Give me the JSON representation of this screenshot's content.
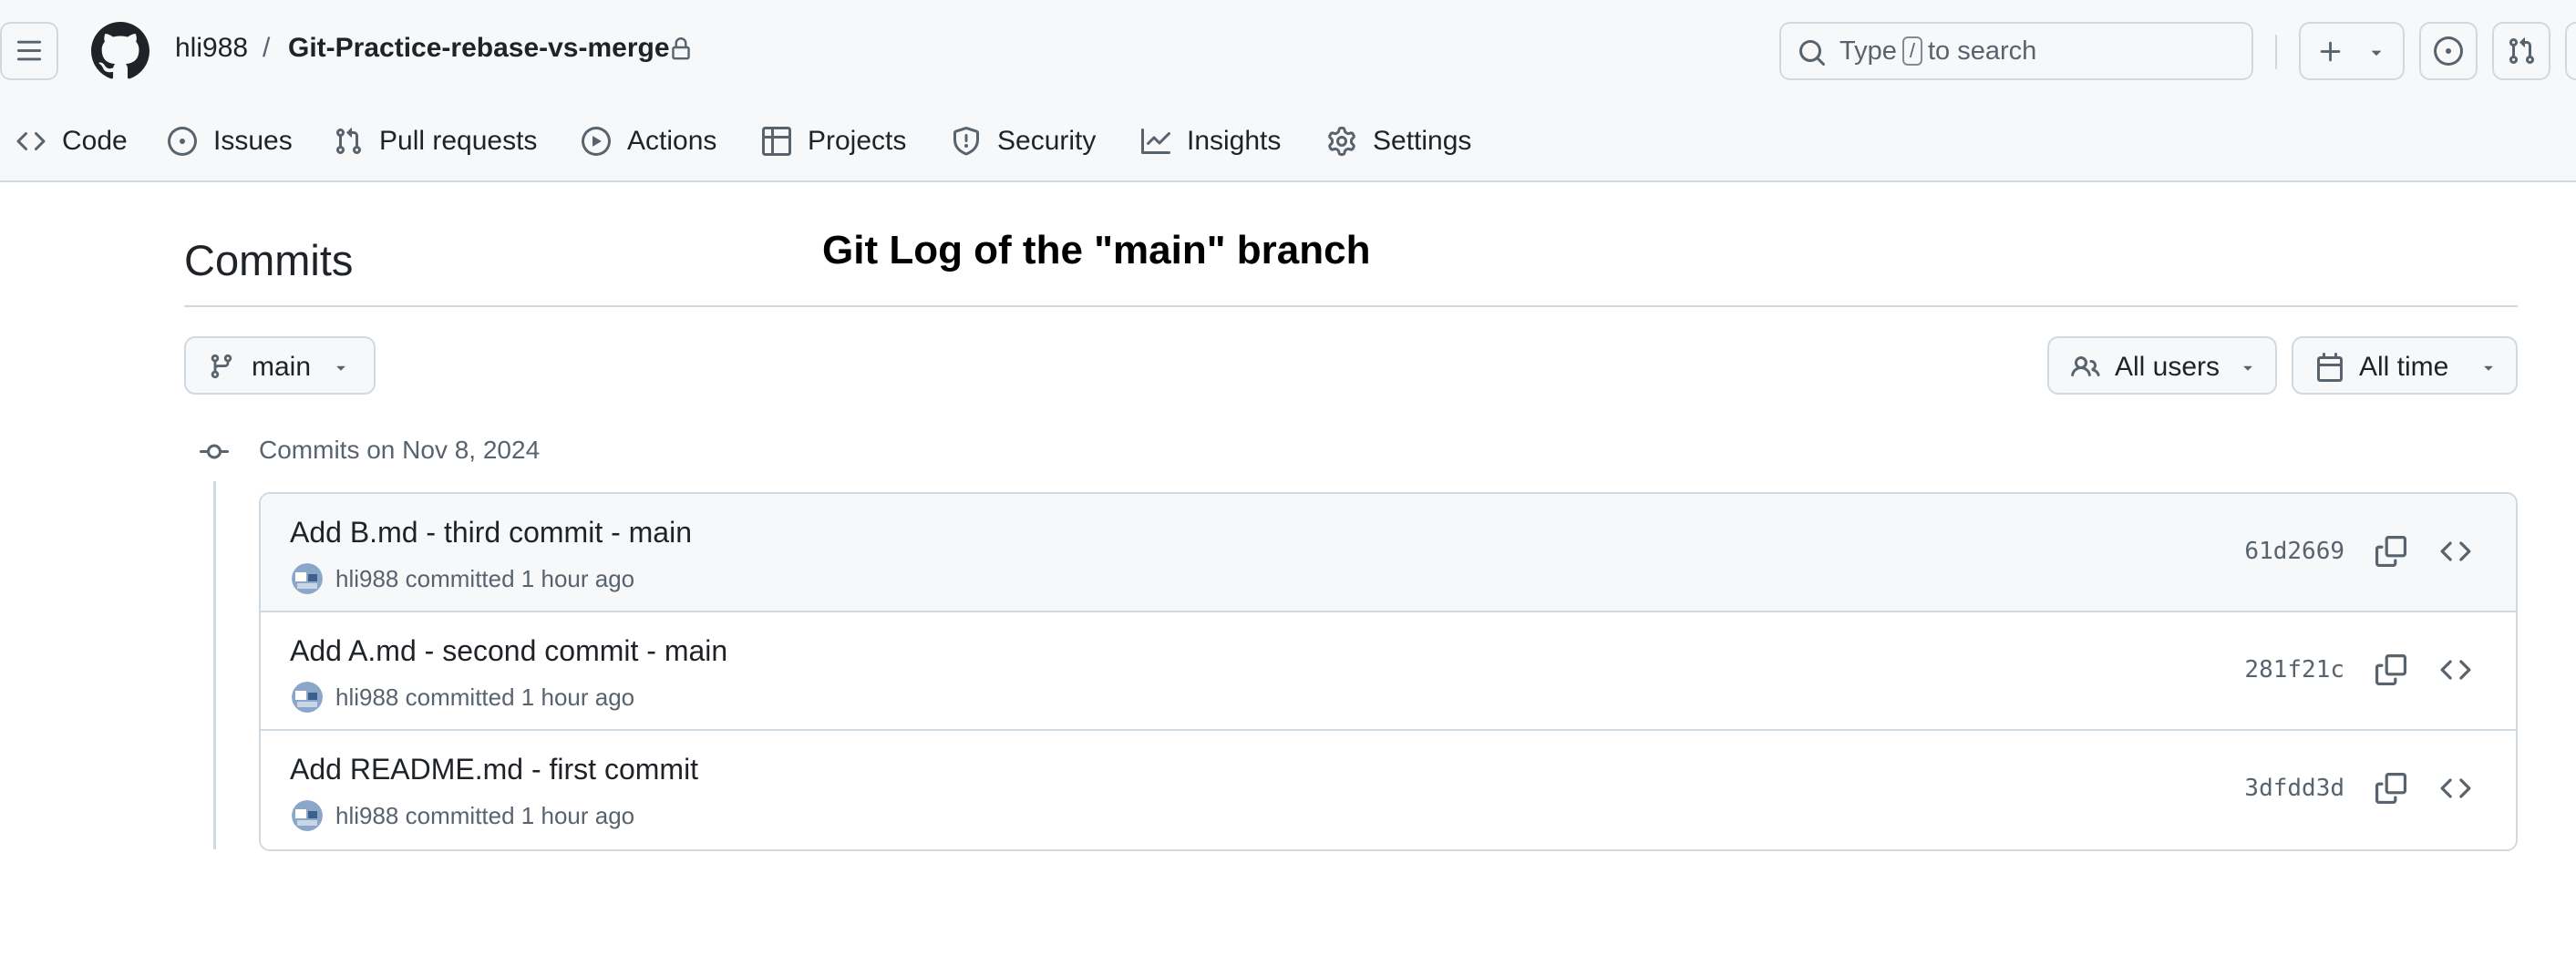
{
  "header": {
    "repo_owner": "hli988",
    "separator": "/",
    "repo_name": "Git-Practice-rebase-vs-merge",
    "search": {
      "prefix": "Type",
      "key": "/",
      "suffix": "to search"
    }
  },
  "nav": {
    "items": [
      {
        "label": "Code",
        "icon": "code-icon"
      },
      {
        "label": "Issues",
        "icon": "issue-opened-icon"
      },
      {
        "label": "Pull requests",
        "icon": "git-pull-request-icon"
      },
      {
        "label": "Actions",
        "icon": "play-icon"
      },
      {
        "label": "Projects",
        "icon": "table-icon"
      },
      {
        "label": "Security",
        "icon": "shield-icon"
      },
      {
        "label": "Insights",
        "icon": "graph-icon"
      },
      {
        "label": "Settings",
        "icon": "gear-icon"
      }
    ]
  },
  "page": {
    "title": "Commits",
    "annotation": "Git Log of the \"main\" branch"
  },
  "filters": {
    "branch": "main",
    "users": "All users",
    "time": "All time"
  },
  "timeline": {
    "date_label": "Commits on Nov 8, 2024"
  },
  "commits": [
    {
      "message": "Add B.md - third commit - main",
      "author": "hli988",
      "action": "committed",
      "time": "1 hour ago",
      "sha": "61d2669"
    },
    {
      "message": "Add A.md - second commit - main",
      "author": "hli988",
      "action": "committed",
      "time": "1 hour ago",
      "sha": "281f21c"
    },
    {
      "message": "Add README.md - first commit",
      "author": "hli988",
      "action": "committed",
      "time": "1 hour ago",
      "sha": "3dfdd3d"
    }
  ],
  "colors": {
    "header_bg": "#f6f8fa",
    "border": "#d1d9e0",
    "text_primary": "#1f2328",
    "text_muted": "#59636e"
  }
}
